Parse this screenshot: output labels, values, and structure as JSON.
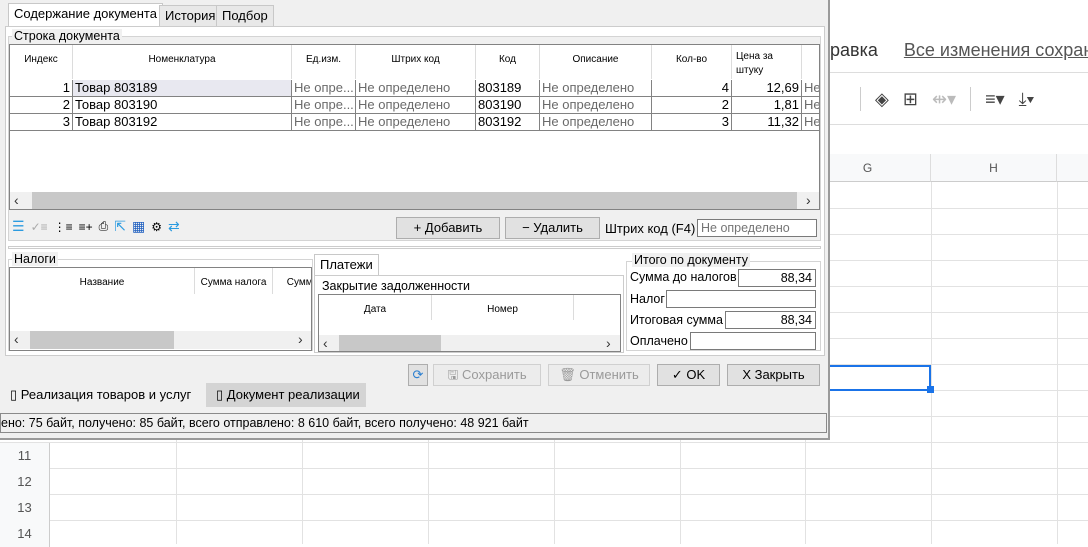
{
  "spreadsheet": {
    "menu_fragment": "равка",
    "saved_status": "Все изменения сохране",
    "columns": [
      "G",
      "H"
    ],
    "rows": [
      "11",
      "12",
      "13",
      "14"
    ]
  },
  "tabs": [
    "Содержание документа",
    "История",
    "Подбор"
  ],
  "doc_rows": {
    "legend": "Строка документа",
    "columns": [
      "Индекс",
      "Номенклатура",
      "Ед.изм.",
      "Штрих код",
      "Код",
      "Описание",
      "Кол-во",
      "Цена за штуку"
    ],
    "rows": [
      [
        "1",
        "Товар 803189",
        "Не опре...",
        "Не определено",
        "803189",
        "Не определено",
        "4",
        "12,69",
        "Не"
      ],
      [
        "2",
        "Товар 803190",
        "Не опре...",
        "Не определено",
        "803190",
        "Не определено",
        "2",
        "1,81",
        "Не"
      ],
      [
        "3",
        "Товар 803192",
        "Не опре...",
        "Не определено",
        "803192",
        "Не определено",
        "3",
        "11,32",
        "Не"
      ]
    ]
  },
  "toolbar": {
    "add": "+ Добавить",
    "delete": "− Удалить",
    "barcode_label": "Штрих код (F4)",
    "barcode_placeholder": "Не определено"
  },
  "taxes": {
    "legend": "Налоги",
    "columns": [
      "Название",
      "Сумма налога",
      "Сумма"
    ]
  },
  "payments": {
    "tab": "Платежи",
    "legend": "Закрытие задолженности",
    "columns": [
      "Дата",
      "Номер"
    ]
  },
  "totals": {
    "legend": "Итого по документу",
    "before_tax_label": "Сумма до налогов",
    "before_tax": "88,34",
    "tax_label": "Налог",
    "tax": "",
    "total_label": "Итоговая сумма",
    "total": "88,34",
    "paid_label": "Оплачено",
    "paid": ""
  },
  "actions": {
    "save": "Сохранить",
    "cancel": "Отменить",
    "ok": "✓ OK",
    "close": "X Закрыть"
  },
  "bottom_tabs": [
    "Реализация товаров и услуг",
    "Документ реализации"
  ],
  "status": "ено: 75 байт, получено: 85 байт, всего отправлено: 8 610 байт, всего получено: 48 921 байт"
}
